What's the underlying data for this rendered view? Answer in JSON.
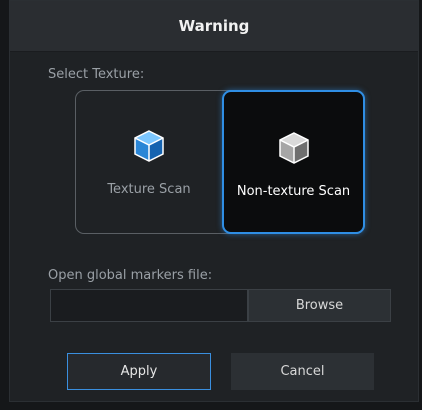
{
  "dialog": {
    "title": "Warning"
  },
  "texture": {
    "section_label": "Select Texture:",
    "options": [
      {
        "label": "Texture Scan",
        "icon": "cube-blue-icon",
        "selected": false
      },
      {
        "label": "Non-texture Scan",
        "icon": "cube-gray-icon",
        "selected": true
      }
    ]
  },
  "markers": {
    "label": "Open global markers file:",
    "file_value": "",
    "browse_label": "Browse"
  },
  "actions": {
    "apply_label": "Apply",
    "cancel_label": "Cancel"
  },
  "colors": {
    "accent": "#2f8ee4",
    "background": "#1f2225",
    "title_bar": "#2a2d31"
  }
}
